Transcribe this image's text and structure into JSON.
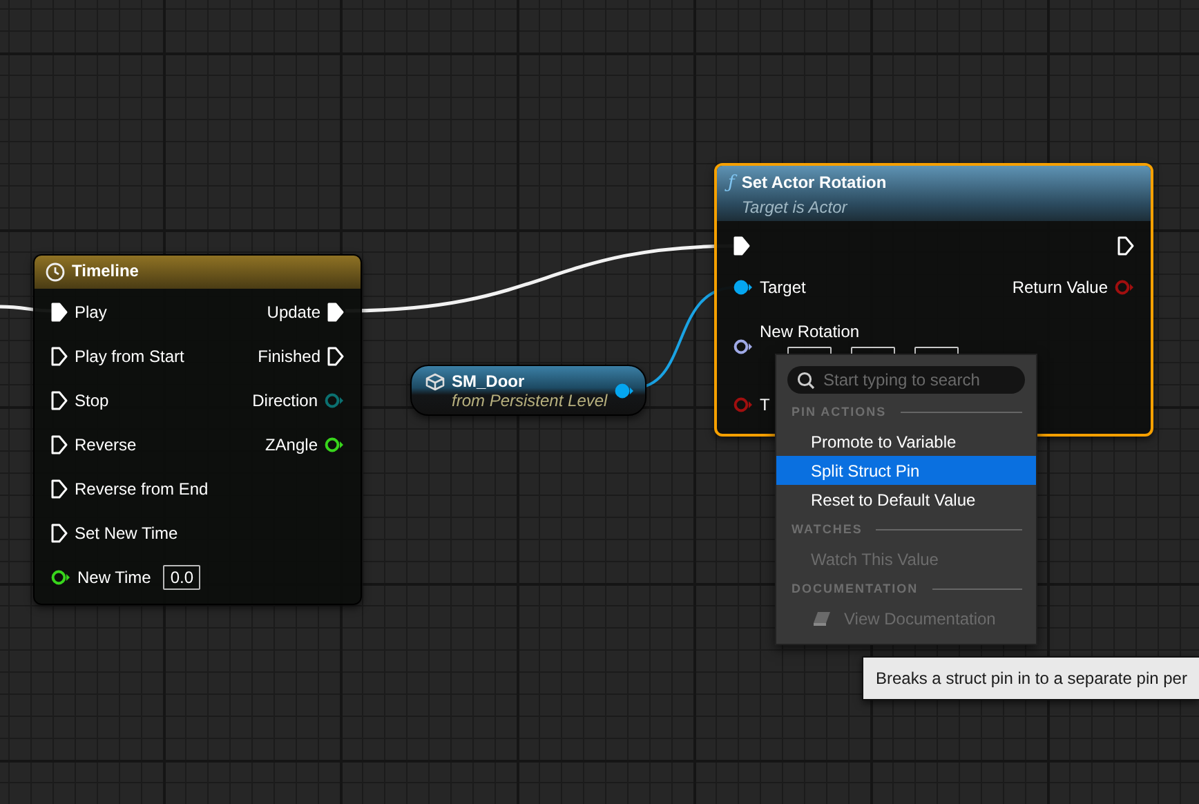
{
  "timeline_node": {
    "title": "Timeline",
    "selected": false,
    "inputs": [
      {
        "label": "Play",
        "kind": "exec",
        "connected": true
      },
      {
        "label": "Play from Start",
        "kind": "exec",
        "connected": false
      },
      {
        "label": "Stop",
        "kind": "exec",
        "connected": false
      },
      {
        "label": "Reverse",
        "kind": "exec",
        "connected": false
      },
      {
        "label": "Reverse from End",
        "kind": "exec",
        "connected": false
      },
      {
        "label": "Set New Time",
        "kind": "exec",
        "connected": false
      },
      {
        "label": "New Time",
        "kind": "float",
        "connected": false,
        "value": "0.0"
      }
    ],
    "outputs": [
      {
        "label": "Update",
        "kind": "exec",
        "connected": true
      },
      {
        "label": "Finished",
        "kind": "exec",
        "connected": false
      },
      {
        "label": "Direction",
        "kind": "enum",
        "connected": false
      },
      {
        "label": "ZAngle",
        "kind": "float",
        "connected": false
      }
    ]
  },
  "variable_node": {
    "title": "SM_Door",
    "subtitle": "from Persistent Level",
    "output": {
      "kind": "object",
      "connected": true
    }
  },
  "function_node": {
    "icon": "ƒ",
    "title": "Set Actor Rotation",
    "subtitle": "Target is Actor",
    "selected": true,
    "inputs": [
      {
        "kind": "exec",
        "connected": true
      },
      {
        "label": "Target",
        "kind": "object",
        "connected": true
      },
      {
        "label": "New Rotation",
        "kind": "rotator",
        "connected": false
      },
      {
        "label": "T",
        "kind": "bool",
        "connected": false
      }
    ],
    "outputs": [
      {
        "kind": "exec",
        "connected": false
      },
      {
        "label": "Return Value",
        "kind": "bool",
        "connected": false
      }
    ]
  },
  "context_menu": {
    "search": {
      "placeholder": "Start typing to search"
    },
    "sections": [
      {
        "heading": "PIN ACTIONS",
        "items": [
          {
            "label": "Promote to Variable",
            "kind": "plain",
            "selected": false,
            "disabled": false
          },
          {
            "label": "Split Struct Pin",
            "kind": "plain",
            "selected": true,
            "disabled": false
          },
          {
            "label": "Reset to Default Value",
            "kind": "plain",
            "selected": false,
            "disabled": false
          }
        ]
      },
      {
        "heading": "WATCHES",
        "items": [
          {
            "label": "Watch This Value",
            "kind": "plain",
            "selected": false,
            "disabled": true
          }
        ]
      },
      {
        "heading": "DOCUMENTATION",
        "items": [
          {
            "label": "View Documentation",
            "kind": "doc",
            "selected": false,
            "disabled": true
          }
        ]
      }
    ]
  },
  "tooltip": {
    "text": "Breaks a struct pin in to a separate pin per"
  }
}
